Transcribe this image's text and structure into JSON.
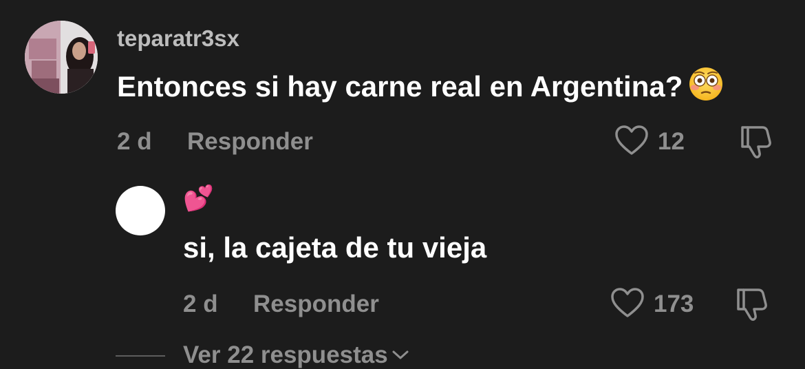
{
  "comment": {
    "username": "teparatr3sx",
    "text": "Entonces si hay carne real en Argentina?",
    "emoji": "flushed-face",
    "time": "2 d",
    "reply_label": "Responder",
    "likes": "12"
  },
  "reply": {
    "username_emoji": "💕",
    "text": "si, la cajeta de tu vieja",
    "time": "2 d",
    "reply_label": "Responder",
    "likes": "173"
  },
  "view_replies": {
    "label": "Ver 22 respuestas"
  },
  "colors": {
    "background": "#1c1c1c",
    "primary_text": "#ffffff",
    "username_text": "#bdbdbd",
    "meta_text": "#8f8f8f"
  }
}
